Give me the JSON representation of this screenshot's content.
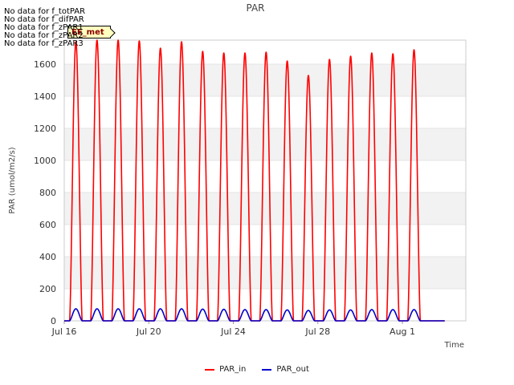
{
  "nodata_messages": [
    "No data for f_totPAR",
    "No data for f_difPAR",
    "No data for f_zPAR1",
    "No data for f_zPAR2",
    "No data for f_zPAR3"
  ],
  "badge_label": "EE_met",
  "chart_data": {
    "type": "line",
    "title": "PAR",
    "xlabel": "Time",
    "ylabel": "PAR (umol/m2/s)",
    "ylim": [
      0,
      1750
    ],
    "yticks": [
      0,
      200,
      400,
      600,
      800,
      1000,
      1200,
      1400,
      1600
    ],
    "xlim": [
      "2022-07-16",
      "2022-08-04"
    ],
    "xticks": [
      {
        "label": "Jul 16",
        "date": "2022-07-16"
      },
      {
        "label": "Jul 20",
        "date": "2022-07-20"
      },
      {
        "label": "Jul 24",
        "date": "2022-07-24"
      },
      {
        "label": "Jul 28",
        "date": "2022-07-28"
      },
      {
        "label": "Aug 1",
        "date": "2022-08-01"
      }
    ],
    "grid": "horizontal-bands",
    "legend": "bottom",
    "days": [
      "2022-07-16",
      "2022-07-17",
      "2022-07-18",
      "2022-07-19",
      "2022-07-20",
      "2022-07-21",
      "2022-07-22",
      "2022-07-23",
      "2022-07-24",
      "2022-07-25",
      "2022-07-26",
      "2022-07-27",
      "2022-07-28",
      "2022-07-29",
      "2022-07-30",
      "2022-07-31",
      "2022-08-01",
      "2022-08-02"
    ],
    "series": [
      {
        "name": "PAR_in",
        "color": "#ff0000",
        "daily_peak": [
          1740,
          1750,
          1750,
          1745,
          1700,
          1740,
          1680,
          1670,
          1670,
          1675,
          1620,
          1530,
          1630,
          1650,
          1670,
          1665,
          1690,
          0
        ]
      },
      {
        "name": "PAR_out",
        "color": "#0000cc",
        "daily_peak": [
          75,
          75,
          75,
          75,
          75,
          75,
          73,
          72,
          70,
          70,
          68,
          65,
          68,
          68,
          70,
          70,
          70,
          0
        ]
      }
    ]
  }
}
